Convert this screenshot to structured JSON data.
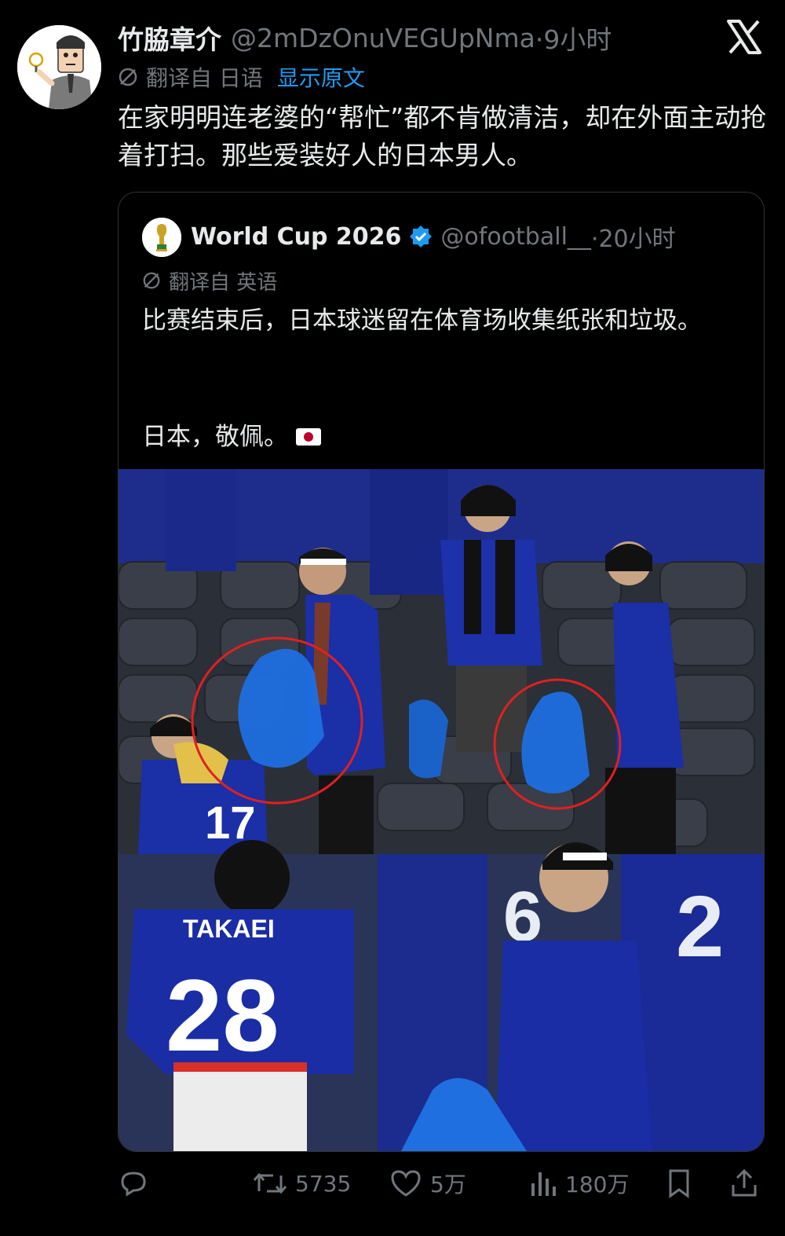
{
  "tweet": {
    "author_name": "竹脇章介",
    "author_handle": "@2mDzOnuVEGUpNma",
    "time": "·9小时",
    "translated_from": "翻译自 日语",
    "show_original": "显示原文",
    "text": "在家明明连老婆的“帮忙”都不肯做清洁，却在外面主动抢着打扫。那些爱装好人的日本男人。"
  },
  "quote": {
    "author_name": "World Cup 2026",
    "author_handle": "@ofootball__",
    "time": "·20小时",
    "translated_from": "翻译自 英语",
    "text": "比赛结束后，日本球迷留在体育场收集纸张和垃圾。",
    "text2": "日本，敬佩。"
  },
  "photo": {
    "jersey_top": "17",
    "jersey_name": "TAKAEI",
    "jersey_number": "28",
    "bg_number_1": "6",
    "bg_number_2": "2",
    "colors": {
      "stadium": "#1f2e8f",
      "jersey": "#1a2a9a",
      "bag": "#1d6fe0",
      "circle": "#e02020"
    }
  },
  "actions": {
    "reply_count": "",
    "retweet_count": "5735",
    "like_count": "5万",
    "view_count": "180万"
  },
  "icons": [
    "x-logo-icon",
    "translate-globe-icon",
    "verified-badge-icon",
    "reply-icon",
    "retweet-icon",
    "like-icon",
    "views-icon",
    "bookmark-icon",
    "share-icon"
  ]
}
